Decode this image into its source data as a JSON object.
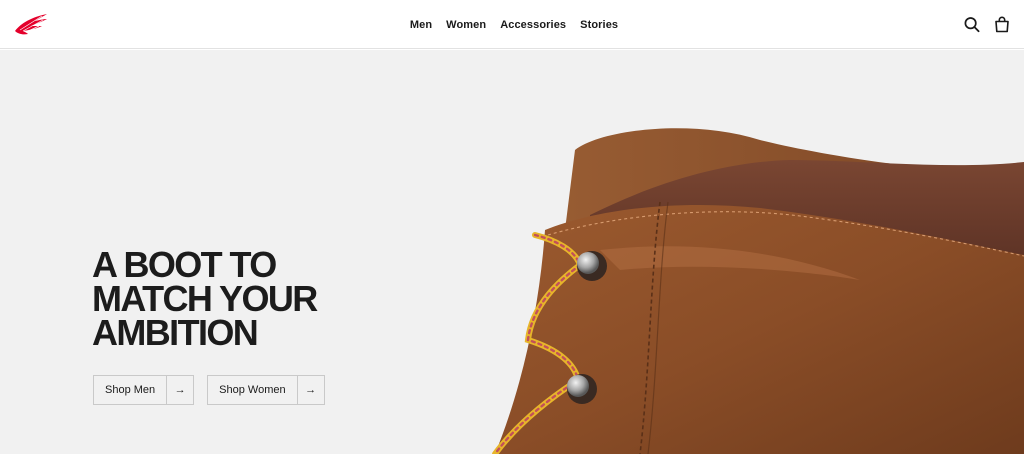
{
  "brand": {
    "logo_icon": "wing-logo-icon",
    "accent_color": "#e4002b"
  },
  "nav": {
    "items": [
      {
        "label": "Men"
      },
      {
        "label": "Women"
      },
      {
        "label": "Accessories"
      },
      {
        "label": "Stories"
      }
    ]
  },
  "header_icons": {
    "search": "search-icon",
    "cart": "shopping-bag-icon"
  },
  "hero": {
    "headline_lines": [
      "A BOOT TO",
      "MATCH YOUR",
      "AMBITION"
    ],
    "background_color": "#f1f1f1",
    "image": "boot-leather-closeup",
    "ctas": [
      {
        "label": "Shop Men",
        "arrow": "→"
      },
      {
        "label": "Shop Women",
        "arrow": "→"
      }
    ]
  }
}
